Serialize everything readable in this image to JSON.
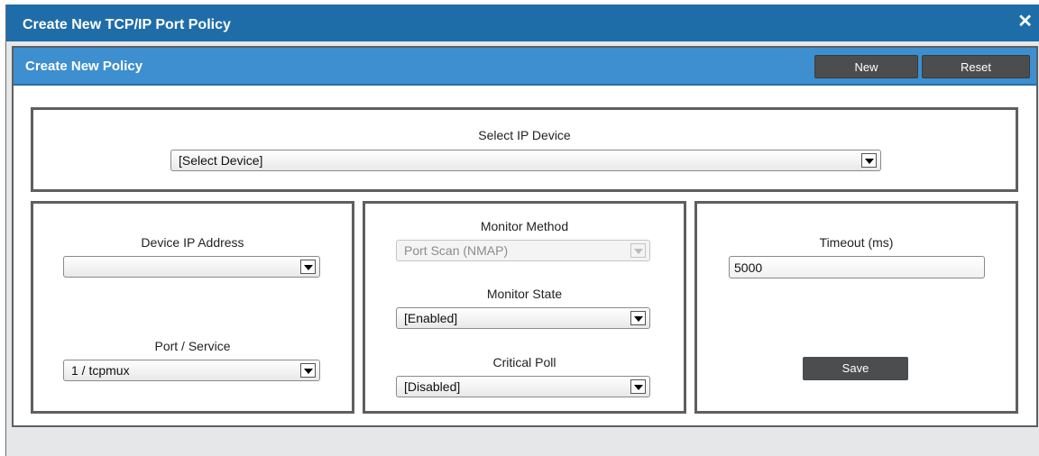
{
  "window": {
    "title": "Create New TCP/IP Port Policy",
    "close_glyph": "✕"
  },
  "panel": {
    "title": "Create New Policy",
    "new_label": "New",
    "reset_label": "Reset"
  },
  "device": {
    "label": "Select IP Device",
    "value": "[Select Device]"
  },
  "left": {
    "ip_label": "Device IP Address",
    "ip_value": "",
    "port_label": "Port / Service",
    "port_value": "1 / tcpmux"
  },
  "middle": {
    "method_label": "Monitor Method",
    "method_value": "Port Scan (NMAP)",
    "state_label": "Monitor State",
    "state_value": "[Enabled]",
    "poll_label": "Critical Poll",
    "poll_value": "[Disabled]"
  },
  "right": {
    "timeout_label": "Timeout (ms)",
    "timeout_value": "5000",
    "save_label": "Save"
  },
  "colors": {
    "titlebar": "#1f6da8",
    "panel_header": "#3d8fcf",
    "button": "#4b4d4f"
  }
}
